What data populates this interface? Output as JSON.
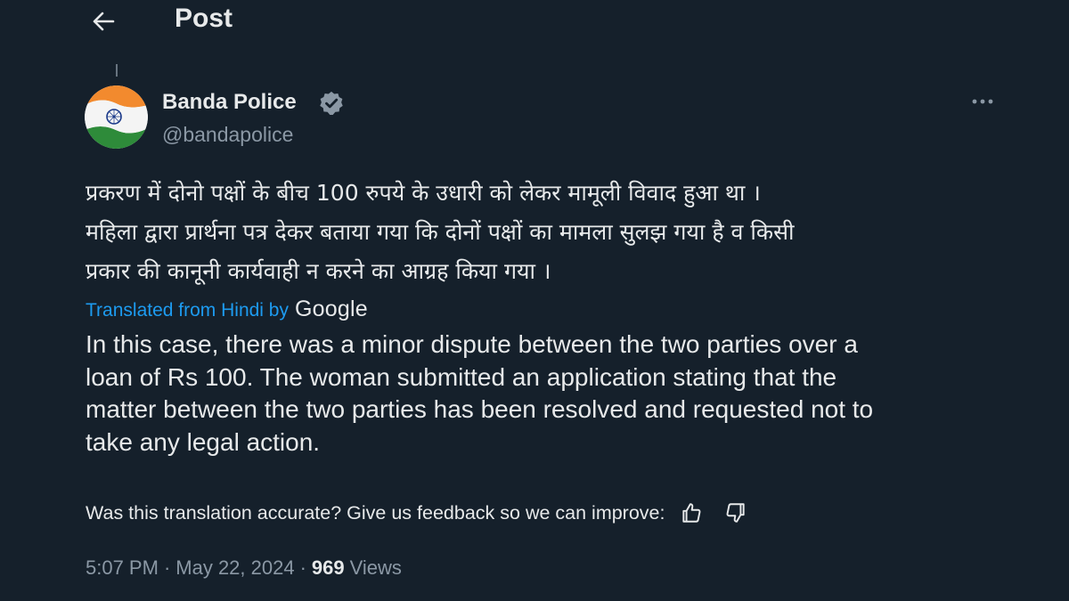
{
  "header": {
    "title": "Post",
    "back_icon": "arrow-left-icon"
  },
  "author": {
    "name": "Banda Police",
    "handle": "@bandapolice",
    "verified_icon": "verified-badge-icon",
    "avatar": "india-flag-avatar"
  },
  "post": {
    "hindi_lines": [
      "प्रकरण में दोनो पक्षों के बीच 100 रुपये के उधारी को लेकर मामूली विवाद हुआ था ।",
      "महिला द्वारा प्रार्थना पत्र देकर बताया गया कि दोनों पक्षों का मामला सुलझ गया है व किसी",
      "प्रकार की कानूनी कार्यवाही न करने का आग्रह किया गया ।"
    ],
    "translated_label": "Translated from Hindi by",
    "translator": "Google",
    "english_lines": [
      "In this case, there was a minor dispute between the two parties over a",
      "loan of Rs 100. The woman submitted an application stating that the",
      "matter between the two parties has been resolved and requested not to",
      "take any legal action."
    ],
    "feedback_prompt": "Was this translation accurate? Give us feedback so we can improve:",
    "time": "5:07 PM",
    "separator": "·",
    "date": "May 22, 2024",
    "views_count": "969",
    "views_label": "Views"
  },
  "colors": {
    "background": "#15202b",
    "text": "#e7e9ea",
    "secondary": "#8b98a5",
    "link": "#1d9bf0"
  }
}
